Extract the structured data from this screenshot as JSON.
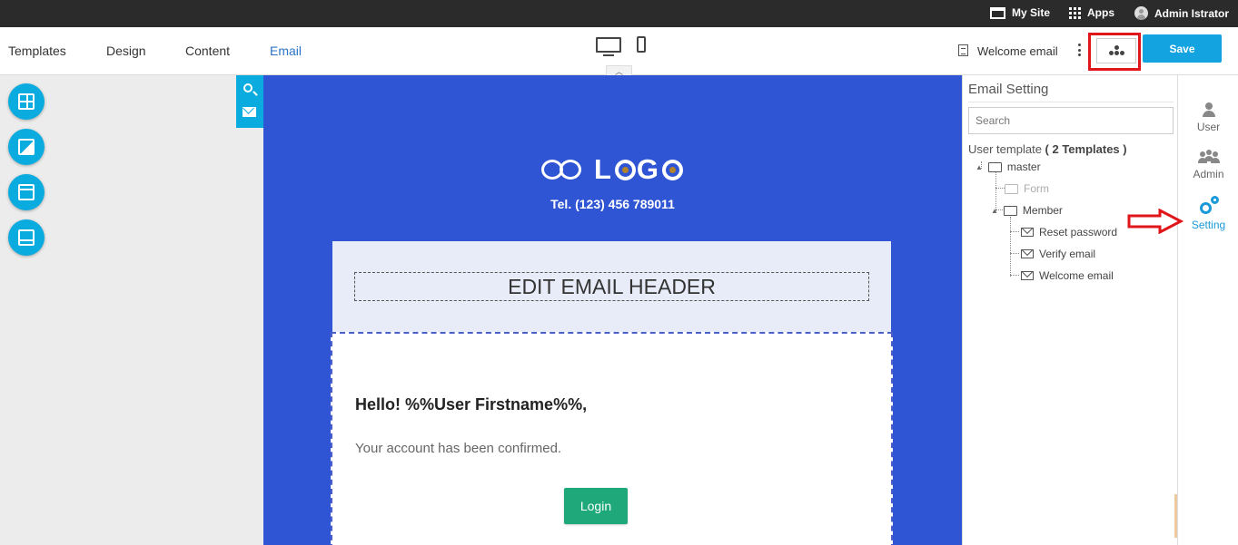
{
  "topbar": {
    "my_site": "My Site",
    "apps": "Apps",
    "user": "Admin Istrator"
  },
  "nav": {
    "tabs": [
      {
        "label": "Templates",
        "active": false
      },
      {
        "label": "Design",
        "active": false
      },
      {
        "label": "Content",
        "active": false
      },
      {
        "label": "Email",
        "active": true
      }
    ]
  },
  "toolbar": {
    "current_template": "Welcome email",
    "save_label": "Save"
  },
  "email": {
    "logo_text_1": "L",
    "logo_text_2": "G",
    "tel": "Tel. (123) 456 789011",
    "header_label": "EDIT EMAIL HEADER",
    "greeting": "Hello! %%User Firstname%%,",
    "body_text": "Your account has been confirmed.",
    "button_label": "Login"
  },
  "panel": {
    "title": "Email Setting",
    "search_placeholder": "Search",
    "tree_prefix": "User template",
    "tree_count": "( 2 Templates )",
    "nodes": {
      "master": "master",
      "form": "Form",
      "member": "Member",
      "reset_password": "Reset password",
      "verify_email": "Verify email",
      "welcome_email": "Welcome email"
    }
  },
  "rail": {
    "user": "User",
    "admin": "Admin",
    "setting": "Setting"
  },
  "colors": {
    "accent": "#13a3e0",
    "canvas": "#2f54d4",
    "highlight": "#e0161b",
    "login_button": "#1fa97a"
  }
}
